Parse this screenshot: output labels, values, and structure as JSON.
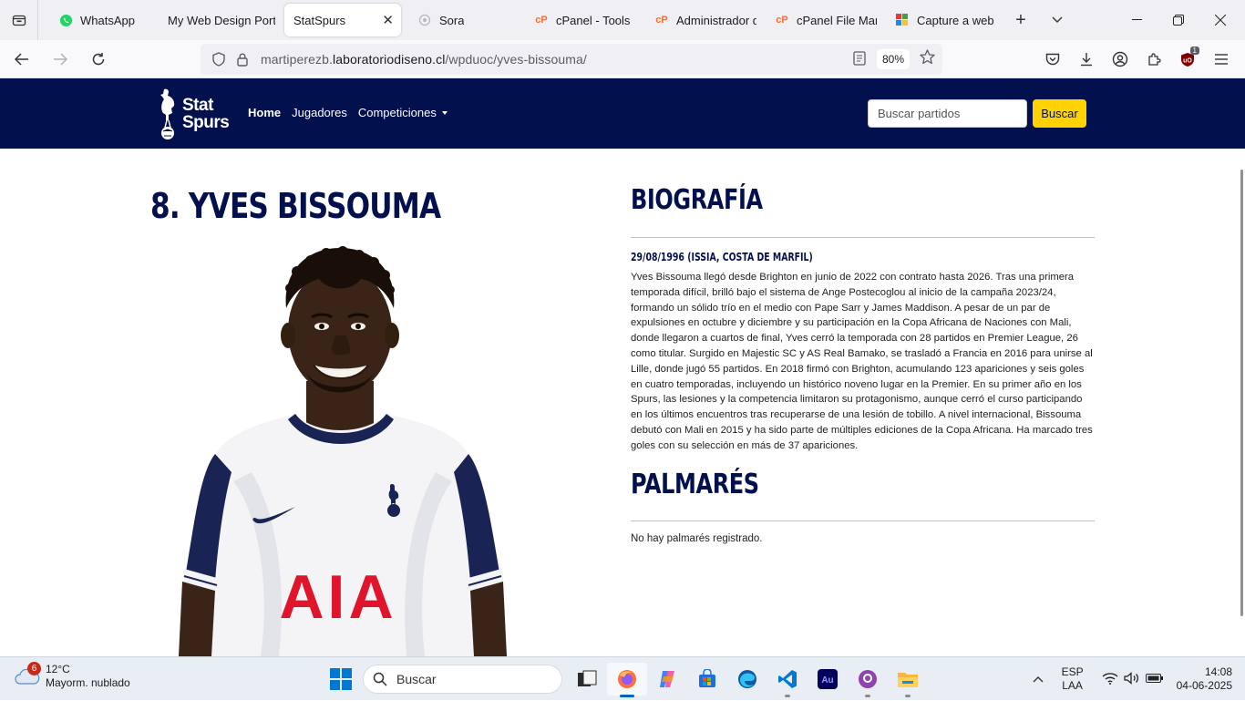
{
  "browser": {
    "tabs": [
      {
        "label": "WhatsApp",
        "icon": "whatsapp-icon"
      },
      {
        "label": "My Web Design Portfolio",
        "icon": "none"
      },
      {
        "label": "StatSpurs",
        "icon": "none",
        "active": true
      },
      {
        "label": "Sora",
        "icon": "sora-icon"
      },
      {
        "label": "cPanel - Tools",
        "icon": "cpanel-icon"
      },
      {
        "label": "Administrador de archivos",
        "icon": "cpanel-icon"
      },
      {
        "label": "cPanel File Manager",
        "icon": "cpanel-icon"
      },
      {
        "label": "Capture a website",
        "icon": "capture-icon"
      }
    ],
    "url_prefix": "martiperezb.",
    "url_host": "laboratoriodiseno.cl",
    "url_path": "/wpduoc/yves-bissouma/",
    "zoom": "80%",
    "extension_badge": "1"
  },
  "site": {
    "logo_line1": "Stat",
    "logo_line2": "Spurs",
    "nav": {
      "home": "Home",
      "players": "Jugadores",
      "competitions": "Competiciones"
    },
    "search_placeholder": "Buscar partidos",
    "search_button": "Buscar",
    "player_title": "8. Yves Bissouma",
    "bio_heading": "Biografía",
    "birth": "29/08/1996 (Issia, Costa de Marfil)",
    "bio_text": "Yves Bissouma llegó desde Brighton en junio de 2022 con contrato hasta 2026. Tras una primera temporada difícil, brilló bajo el sistema de Ange Postecoglou al inicio de la campaña 2023/24, formando un sólido trío en el medio con Pape Sarr y James Maddison. A pesar de un par de expulsiones en octubre y diciembre y su participación en la Copa Africana de Naciones con Mali, donde llegaron a cuartos de final, Yves cerró la temporada con 28 partidos en Premier League, 26 como titular. Surgido en Majestic SC y AS Real Bamako, se trasladó a Francia en 2016 para unirse al Lille, donde jugó 55 partidos. En 2018 firmó con Brighton, acumulando 123 apariciones y seis goles en cuatro temporadas, incluyendo un histórico noveno lugar en la Premier. En su primer año en los Spurs, las lesiones y la competencia limitaron su protagonismo, aunque cerró el curso participando en los últimos encuentros tras recuperarse de una lesión de tobillo. A nivel internacional, Bissouma debutó con Mali en 2015 y ha sido parte de múltiples ediciones de la Copa Africana. Ha marcado tres goles con su selección en más de 37 apariciones.",
    "honors_heading": "Palmarés",
    "honors_empty": "No hay palmarés registrado.",
    "shirt_sponsor": "AIA",
    "colors": {
      "navy": "#02104d",
      "yellow": "#ffd200"
    }
  },
  "taskbar": {
    "weather_temp": "12°C",
    "weather_desc": "Mayorm. nublado",
    "weather_badge": "6",
    "search_label": "Buscar",
    "lang_1": "ESP",
    "lang_2": "LAA",
    "time": "14:08",
    "date": "04-06-2025"
  }
}
